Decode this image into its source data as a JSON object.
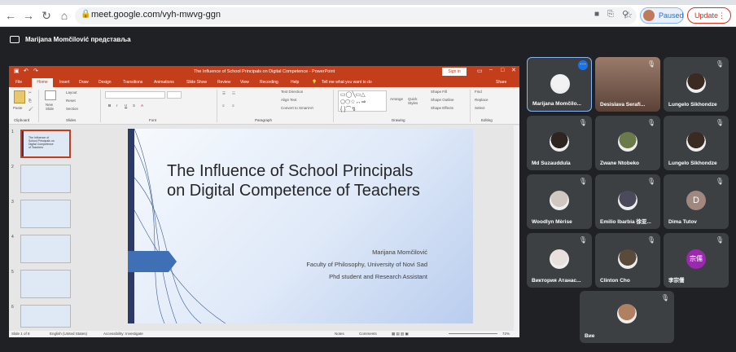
{
  "browser": {
    "url": "meet.google.com/vyh-mwvg-ggn",
    "paused_label": "Paused",
    "update_label": "Update"
  },
  "meet": {
    "presenter_text": "Marijana Momčilović представља"
  },
  "ppt": {
    "window_title": "The Influence of School Principals on Digital Competence - PowerPoint",
    "signin": "Sign in",
    "menu": [
      "File",
      "Home",
      "Insert",
      "Draw",
      "Design",
      "Transitions",
      "Animations",
      "Slide Show",
      "Review",
      "View",
      "Recording",
      "Help"
    ],
    "tell_me": "Tell me what you want to do",
    "share": "Share",
    "ribbon_groups": [
      "Clipboard",
      "Slides",
      "Font",
      "Paragraph",
      "Drawing",
      "Editing"
    ],
    "ribbon": {
      "paste": "Paste",
      "new_slide": "New Slide",
      "layout": "Layout",
      "reset": "Reset",
      "section": "Section",
      "find": "Find",
      "replace": "Replace",
      "select": "Select",
      "arrange": "Arrange",
      "quick_styles": "Quick Styles",
      "shape_fill": "Shape Fill",
      "shape_outline": "Shape Outline",
      "shape_effects": "Shape Effects",
      "text_direction": "Text Direction",
      "align_text": "Align Text",
      "convert_smartart": "Convert to SmartArt"
    },
    "slide": {
      "title": "The Influence of School Principals on Digital Competence of Teachers",
      "subtitle_lines": [
        "Marijana Momčilović",
        "Faculty of Philosophy, University of Novi Sad",
        "Phd student and Research Assistant"
      ]
    },
    "thumb_numbers": [
      "1",
      "2",
      "3",
      "4",
      "5",
      "6"
    ],
    "thumb1_text": "The Influence of School Principals on Digital Competence of Teachers",
    "status": {
      "slide_of": "Slide 1 of 8",
      "language": "English (United States)",
      "accessibility": "Accessibility: Investigate",
      "notes": "Notes",
      "comments": "Comments",
      "zoom": "72%"
    }
  },
  "participants": [
    {
      "name": "Marijana Momčilo...",
      "kind": "photo",
      "color": "#f2f2f2"
    },
    {
      "name": "Desislava Serafi...",
      "kind": "video",
      "color": "#8a6b5c"
    },
    {
      "name": "Lungelo Sikhondze",
      "kind": "photo",
      "color": "#3a2a22"
    },
    {
      "name": "Md Suzauddula",
      "kind": "photo",
      "color": "#2d2520"
    },
    {
      "name": "Zwane Ntobeko",
      "kind": "photo",
      "color": "#6b7a4a"
    },
    {
      "name": "Lungelo Sikhondze",
      "kind": "photo",
      "color": "#3a2a22"
    },
    {
      "name": "Woodlyn Mèrise",
      "kind": "photo",
      "color": "#d0c8c0"
    },
    {
      "name": "Emilio Ibarbia 徐亚...",
      "kind": "photo",
      "color": "#4a4a5a"
    },
    {
      "name": "Dima Tutov",
      "kind": "letter",
      "letter": "D",
      "color": "#a1887f"
    },
    {
      "name": "Виктория Атанас...",
      "kind": "photo",
      "color": "#e8e0dc"
    },
    {
      "name": "Clinton Cho",
      "kind": "photo",
      "color": "#5a4a3a"
    },
    {
      "name": "李宗儒",
      "kind": "letter",
      "letter": "宗儒",
      "color": "#9c27b0"
    },
    {
      "name": "Вие",
      "kind": "photo",
      "color": "#b08060"
    }
  ]
}
